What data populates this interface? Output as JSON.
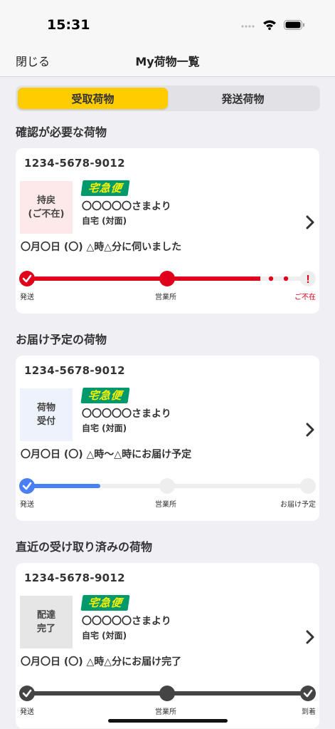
{
  "status_bar": {
    "time": "15:31",
    "icons": [
      "signal-icon",
      "wifi-icon",
      "battery-icon"
    ]
  },
  "nav": {
    "close_label": "閉じる",
    "title": "My荷物一覧"
  },
  "tabs": [
    {
      "label": "受取荷物",
      "active": true
    },
    {
      "label": "発送荷物",
      "active": false
    }
  ],
  "colors": {
    "accent_yellow": "#ffcc00",
    "alert_red": "#e0001b",
    "progress_blue": "#4a7ef5",
    "done_dark": "#444444",
    "logo_green": "#00996b",
    "logo_text": "#fff100"
  },
  "sections": [
    {
      "title": "確認が必要な荷物",
      "card": {
        "tracking_number": "1234-5678-9012",
        "status_lines": [
          "持戻",
          "(ご不在)"
        ],
        "status_bg": "#fde8ea",
        "logo_text": "宅急便",
        "sender": "〇〇〇〇〇さまより",
        "delivery_type": "自宅 (対面)",
        "message": "〇月〇日 (〇) △時△分に伺いました",
        "progress": {
          "style": "alert",
          "steps": [
            "発送",
            "営業所",
            "ご不在"
          ],
          "step_states": [
            "done",
            "current",
            "alert"
          ]
        }
      }
    },
    {
      "title": "お届け予定の荷物",
      "card": {
        "tracking_number": "1234-5678-9012",
        "status_lines": [
          "荷物",
          "受付"
        ],
        "status_bg": "#eef2fc",
        "logo_text": "宅急便",
        "sender": "〇〇〇〇〇さまより",
        "delivery_type": "自宅 (対面)",
        "message": "〇月〇日 (〇) △時〜△時にお届け予定",
        "progress": {
          "style": "pending",
          "steps": [
            "発送",
            "営業所",
            "お届け予定"
          ],
          "step_states": [
            "done",
            "pending",
            "pending"
          ]
        }
      }
    },
    {
      "title": "直近の受け取り済みの荷物",
      "card": {
        "tracking_number": "1234-5678-9012",
        "status_lines": [
          "配達",
          "完了"
        ],
        "status_bg": "#e6e6e6",
        "logo_text": "宅急便",
        "sender": "〇〇〇〇〇さまより",
        "delivery_type": "自宅 (対面)",
        "message": "〇月〇日 (〇) △時△分にお届け完了",
        "progress": {
          "style": "complete",
          "steps": [
            "発送",
            "営業所",
            "到着"
          ],
          "step_states": [
            "done",
            "current",
            "done"
          ]
        }
      }
    }
  ]
}
